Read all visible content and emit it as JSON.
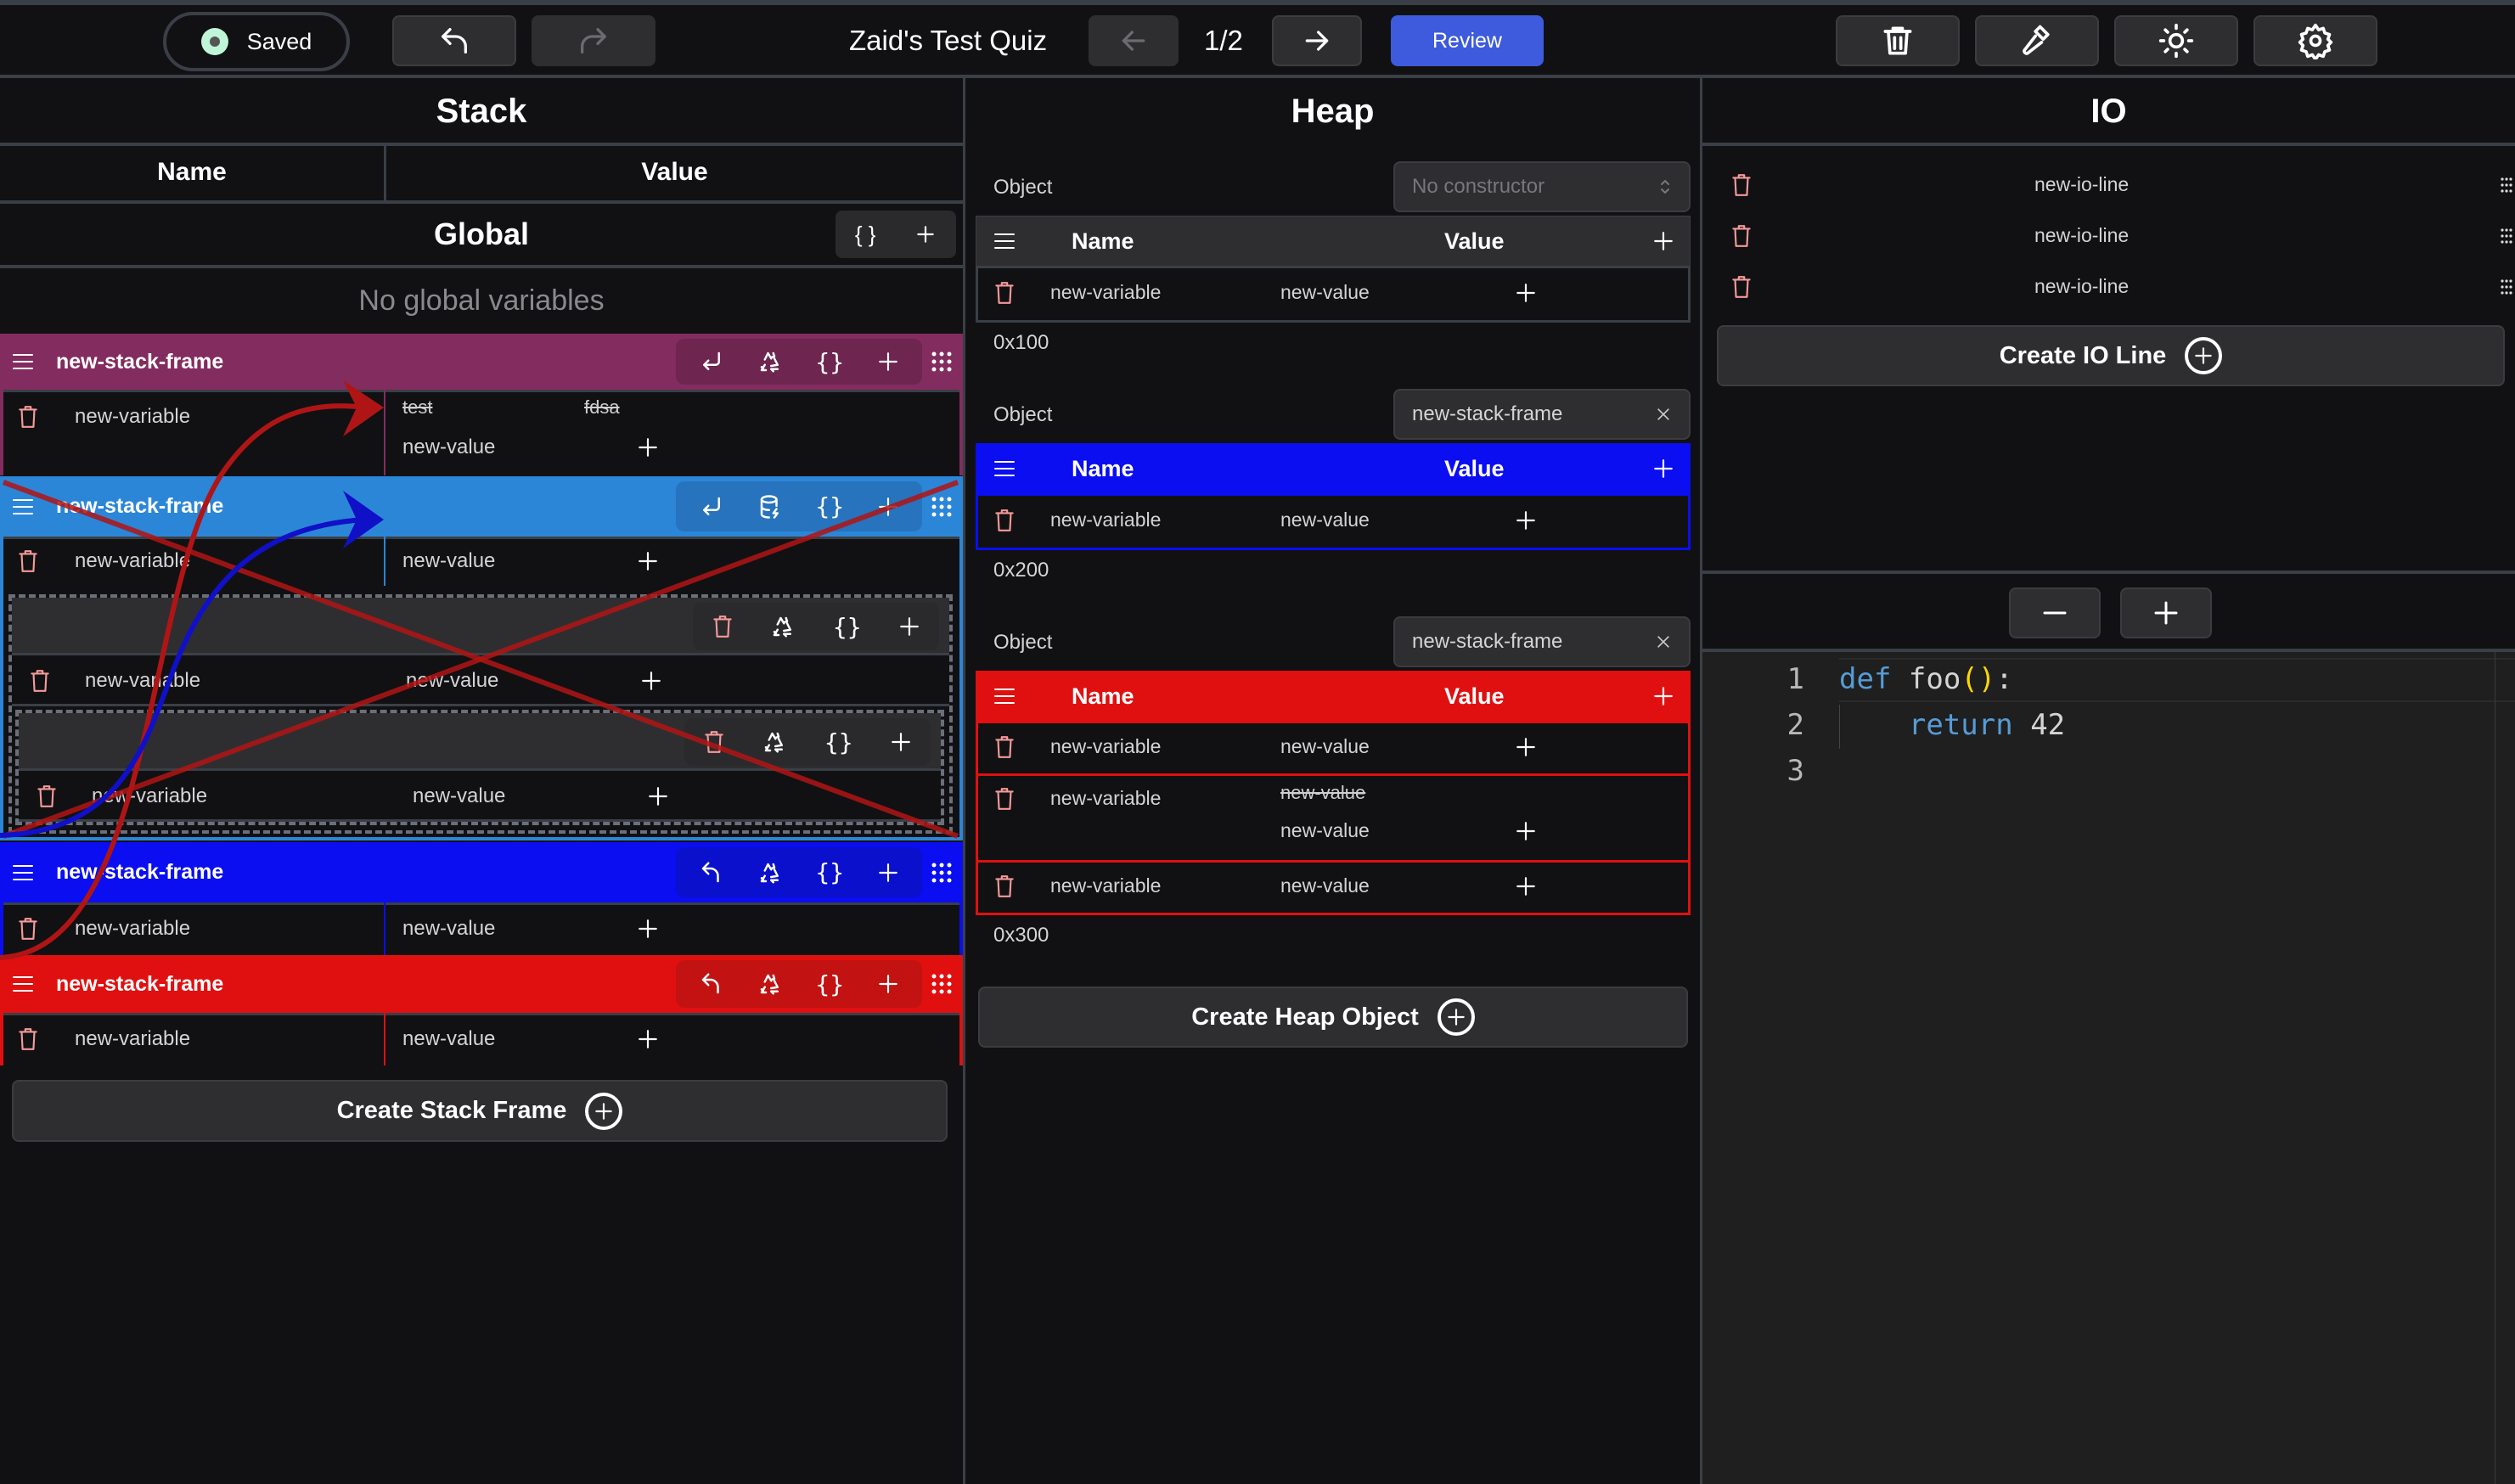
{
  "header": {
    "save_status": "Saved",
    "undo_label": "undo",
    "redo_label": "redo",
    "quiz_title": "Zaid's Test Quiz",
    "page_indicator": "1/2",
    "review_label": "Review",
    "icons": [
      "trash-icon",
      "hammer-icon",
      "sun-icon",
      "gear-icon"
    ]
  },
  "panels": {
    "stack_title": "Stack",
    "heap_title": "Heap",
    "io_title": "IO"
  },
  "stack": {
    "col_name": "Name",
    "col_value": "Value",
    "global_label": "Global",
    "global_braces": "{ }",
    "no_globals": "No global variables",
    "frames": [
      {
        "name": "new-stack-frame",
        "color": "#832c5f",
        "action_bg": "#6e2550",
        "variables": [
          {
            "name": "new-variable",
            "old_values": [
              "test",
              "fdsa"
            ],
            "value": "new-value"
          }
        ]
      },
      {
        "name": "new-stack-frame",
        "color": "#2b86d8",
        "action_bg": "#2773bd",
        "variables": [
          {
            "name": "new-variable",
            "value": "new-value"
          }
        ],
        "nested": [
          {
            "name": "new-variable",
            "value": "new-value"
          },
          {
            "name": "new-variable",
            "value": "new-value"
          }
        ]
      },
      {
        "name": "new-stack-frame",
        "color": "#0a0ef0",
        "action_bg": "#0a10cc",
        "variables": [
          {
            "name": "new-variable",
            "value": "new-value"
          }
        ]
      },
      {
        "name": "new-stack-frame",
        "color": "#e01010",
        "action_bg": "#c21212",
        "variables": [
          {
            "name": "new-variable",
            "value": "new-value"
          }
        ]
      }
    ],
    "create_label": "Create Stack Frame"
  },
  "heap": {
    "objects": [
      {
        "label": "Object",
        "constructor_placeholder": "No constructor",
        "constructor": "",
        "color": "#2e2e30",
        "col_name": "Name",
        "col_value": "Value",
        "rows": [
          {
            "name": "new-variable",
            "value": "new-value"
          }
        ],
        "address": "0x100"
      },
      {
        "label": "Object",
        "constructor": "new-stack-frame",
        "color": "#0a0ef0",
        "col_name": "Name",
        "col_value": "Value",
        "rows": [
          {
            "name": "new-variable",
            "value": "new-value"
          }
        ],
        "address": "0x200"
      },
      {
        "label": "Object",
        "constructor": "new-stack-frame",
        "color": "#e01010",
        "col_name": "Name",
        "col_value": "Value",
        "rows": [
          {
            "name": "new-variable",
            "value": "new-value"
          },
          {
            "name": "new-variable",
            "old_value": "new-value",
            "value": "new-value"
          },
          {
            "name": "new-variable",
            "value": "new-value"
          }
        ],
        "address": "0x300"
      }
    ],
    "create_label": "Create Heap Object"
  },
  "io": {
    "lines": [
      "new-io-line",
      "new-io-line",
      "new-io-line"
    ],
    "create_label": "Create IO Line"
  },
  "editor": {
    "line_numbers": [
      "1",
      "2",
      "3"
    ],
    "code": [
      [
        {
          "t": "def",
          "c": "kw"
        },
        {
          "t": " foo",
          "c": "fn"
        },
        {
          "t": "()",
          "c": "paren"
        },
        {
          "t": ":",
          "c": "fn"
        }
      ],
      [
        {
          "t": "    ",
          "c": "fn"
        },
        {
          "t": "return",
          "c": "kw"
        },
        {
          "t": " 42",
          "c": "fn"
        }
      ],
      []
    ]
  },
  "colors": {
    "accent_review": "#3d5bdc",
    "trash": "#f59a9a",
    "arrow_red": "#b01515",
    "arrow_blue": "#1010c8",
    "cross_red": "#b01515"
  }
}
